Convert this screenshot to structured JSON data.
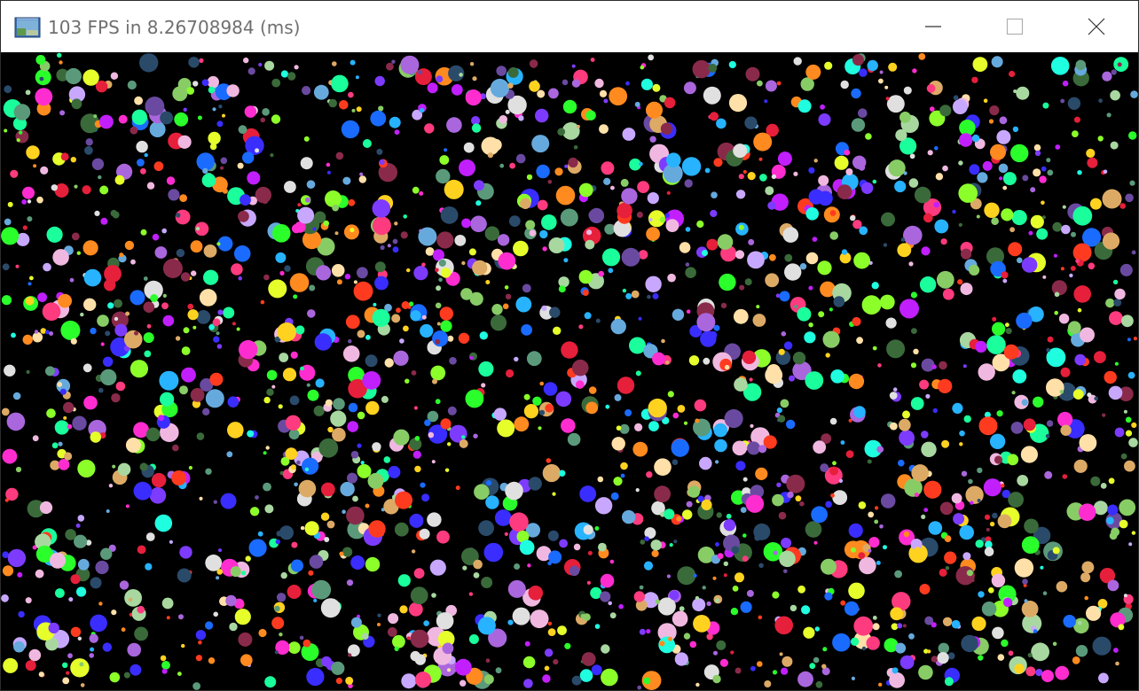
{
  "window": {
    "title": "103 FPS in 8.26708984 (ms)",
    "app_icon": "app-window-icon",
    "buttons": {
      "minimize": "minimize-icon",
      "maximize": "maximize-icon",
      "close": "close-icon"
    }
  },
  "canvas": {
    "background": "#000000",
    "particle_palette": [
      "#ff3b7f",
      "#ff2dd0",
      "#c21fff",
      "#7d3bff",
      "#3a2dff",
      "#1a6bff",
      "#27b3ff",
      "#1fffe0",
      "#1aff9c",
      "#2bff2b",
      "#8cff2b",
      "#e6ff2b",
      "#ffd21f",
      "#ff8a1f",
      "#ff3b1f",
      "#e61f3b",
      "#a8d8a0",
      "#f0b8e0",
      "#c8a8ff",
      "#ffe0a8",
      "#5a9a7a",
      "#6a4aa0",
      "#3a6a3a",
      "#2a4a6a",
      "#8a2a4a",
      "#e0e0e0",
      "#88cc66",
      "#aa66dd",
      "#66aadd",
      "#ddaa66"
    ]
  }
}
